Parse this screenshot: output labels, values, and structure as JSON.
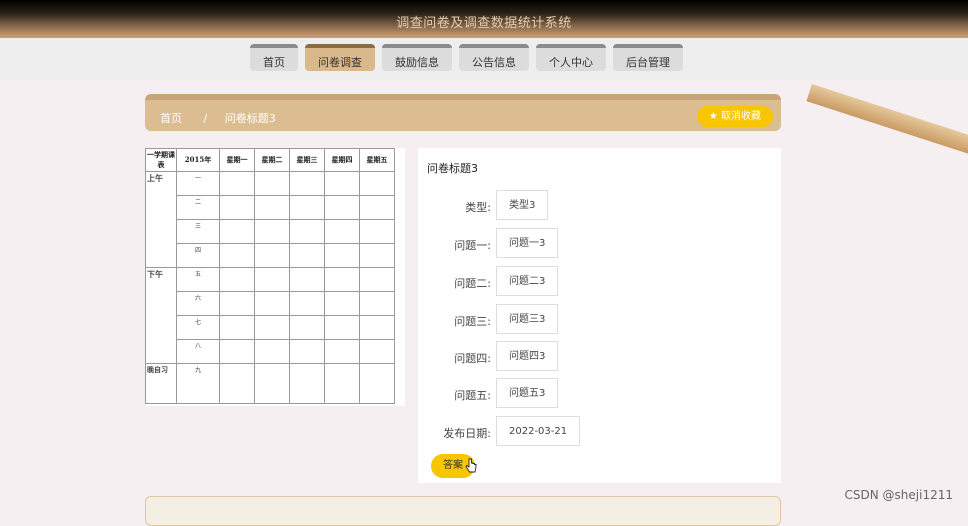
{
  "header": {
    "title": "调查问卷及调查数据统计系统"
  },
  "nav": {
    "items": [
      {
        "label": "首页",
        "active": false
      },
      {
        "label": "问卷调查",
        "active": true
      },
      {
        "label": "鼓励信息",
        "active": false
      },
      {
        "label": "公告信息",
        "active": false
      },
      {
        "label": "个人中心",
        "active": false
      },
      {
        "label": "后台管理",
        "active": false
      }
    ]
  },
  "breadcrumb": {
    "home": "首页",
    "separator": "/",
    "current": "问卷标题3"
  },
  "favorite_button": {
    "icon": "star-icon",
    "label": "取消收藏"
  },
  "timetable": {
    "corner": "一学期课表",
    "year": "2015年",
    "days": [
      "星期一",
      "星期二",
      "星期三",
      "星期四",
      "星期五"
    ],
    "morning": "上午",
    "afternoon": "下午",
    "evening": "晚自习",
    "periods": [
      "一",
      "二",
      "三",
      "四",
      "五",
      "六",
      "七",
      "八",
      "九"
    ]
  },
  "detail": {
    "title": "问卷标题3",
    "fields": [
      {
        "label": "类型:",
        "value": "类型3"
      },
      {
        "label": "问题一:",
        "value": "问题一3"
      },
      {
        "label": "问题二:",
        "value": "问题二3"
      },
      {
        "label": "问题三:",
        "value": "问题三3"
      },
      {
        "label": "问题四:",
        "value": "问题四3"
      },
      {
        "label": "问题五:",
        "value": "问题五3"
      },
      {
        "label": "发布日期:",
        "value": "2022-03-21"
      }
    ],
    "answer_button": "答案"
  },
  "watermark": "CSDN @sheji1211",
  "colors": {
    "accent": "#f7c600",
    "nav_active": "#d9b88b",
    "breadcrumb_bg": "#dcbd92"
  }
}
